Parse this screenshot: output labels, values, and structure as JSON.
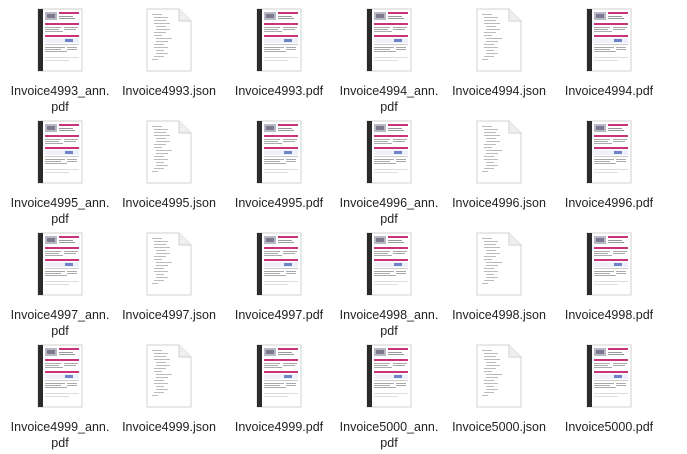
{
  "window": {
    "title": ""
  },
  "colors": {
    "accent": "#c8337a",
    "doc_page": "#ffffff",
    "doc_sidebar": "#2b2b2b",
    "label_text": "#222222"
  },
  "files": [
    {
      "name": "Invoice4993_ann.\npdf",
      "kind": "pdf"
    },
    {
      "name": "Invoice4993.json",
      "kind": "json"
    },
    {
      "name": "Invoice4993.pdf",
      "kind": "pdf"
    },
    {
      "name": "Invoice4994_ann.\npdf",
      "kind": "pdf"
    },
    {
      "name": "Invoice4994.json",
      "kind": "json"
    },
    {
      "name": "Invoice4994.pdf",
      "kind": "pdf"
    },
    {
      "name": "Invoice4995_ann.\npdf",
      "kind": "pdf"
    },
    {
      "name": "Invoice4995.json",
      "kind": "json"
    },
    {
      "name": "Invoice4995.pdf",
      "kind": "pdf"
    },
    {
      "name": "Invoice4996_ann.\npdf",
      "kind": "pdf"
    },
    {
      "name": "Invoice4996.json",
      "kind": "json"
    },
    {
      "name": "Invoice4996.pdf",
      "kind": "pdf"
    },
    {
      "name": "Invoice4997_ann.\npdf",
      "kind": "pdf"
    },
    {
      "name": "Invoice4997.json",
      "kind": "json"
    },
    {
      "name": "Invoice4997.pdf",
      "kind": "pdf"
    },
    {
      "name": "Invoice4998_ann.\npdf",
      "kind": "pdf"
    },
    {
      "name": "Invoice4998.json",
      "kind": "json"
    },
    {
      "name": "Invoice4998.pdf",
      "kind": "pdf"
    },
    {
      "name": "Invoice4999_ann.\npdf",
      "kind": "pdf"
    },
    {
      "name": "Invoice4999.json",
      "kind": "json"
    },
    {
      "name": "Invoice4999.pdf",
      "kind": "pdf"
    },
    {
      "name": "Invoice5000_ann.\npdf",
      "kind": "pdf"
    },
    {
      "name": "Invoice5000.json",
      "kind": "json"
    },
    {
      "name": "Invoice5000.pdf",
      "kind": "pdf"
    }
  ]
}
